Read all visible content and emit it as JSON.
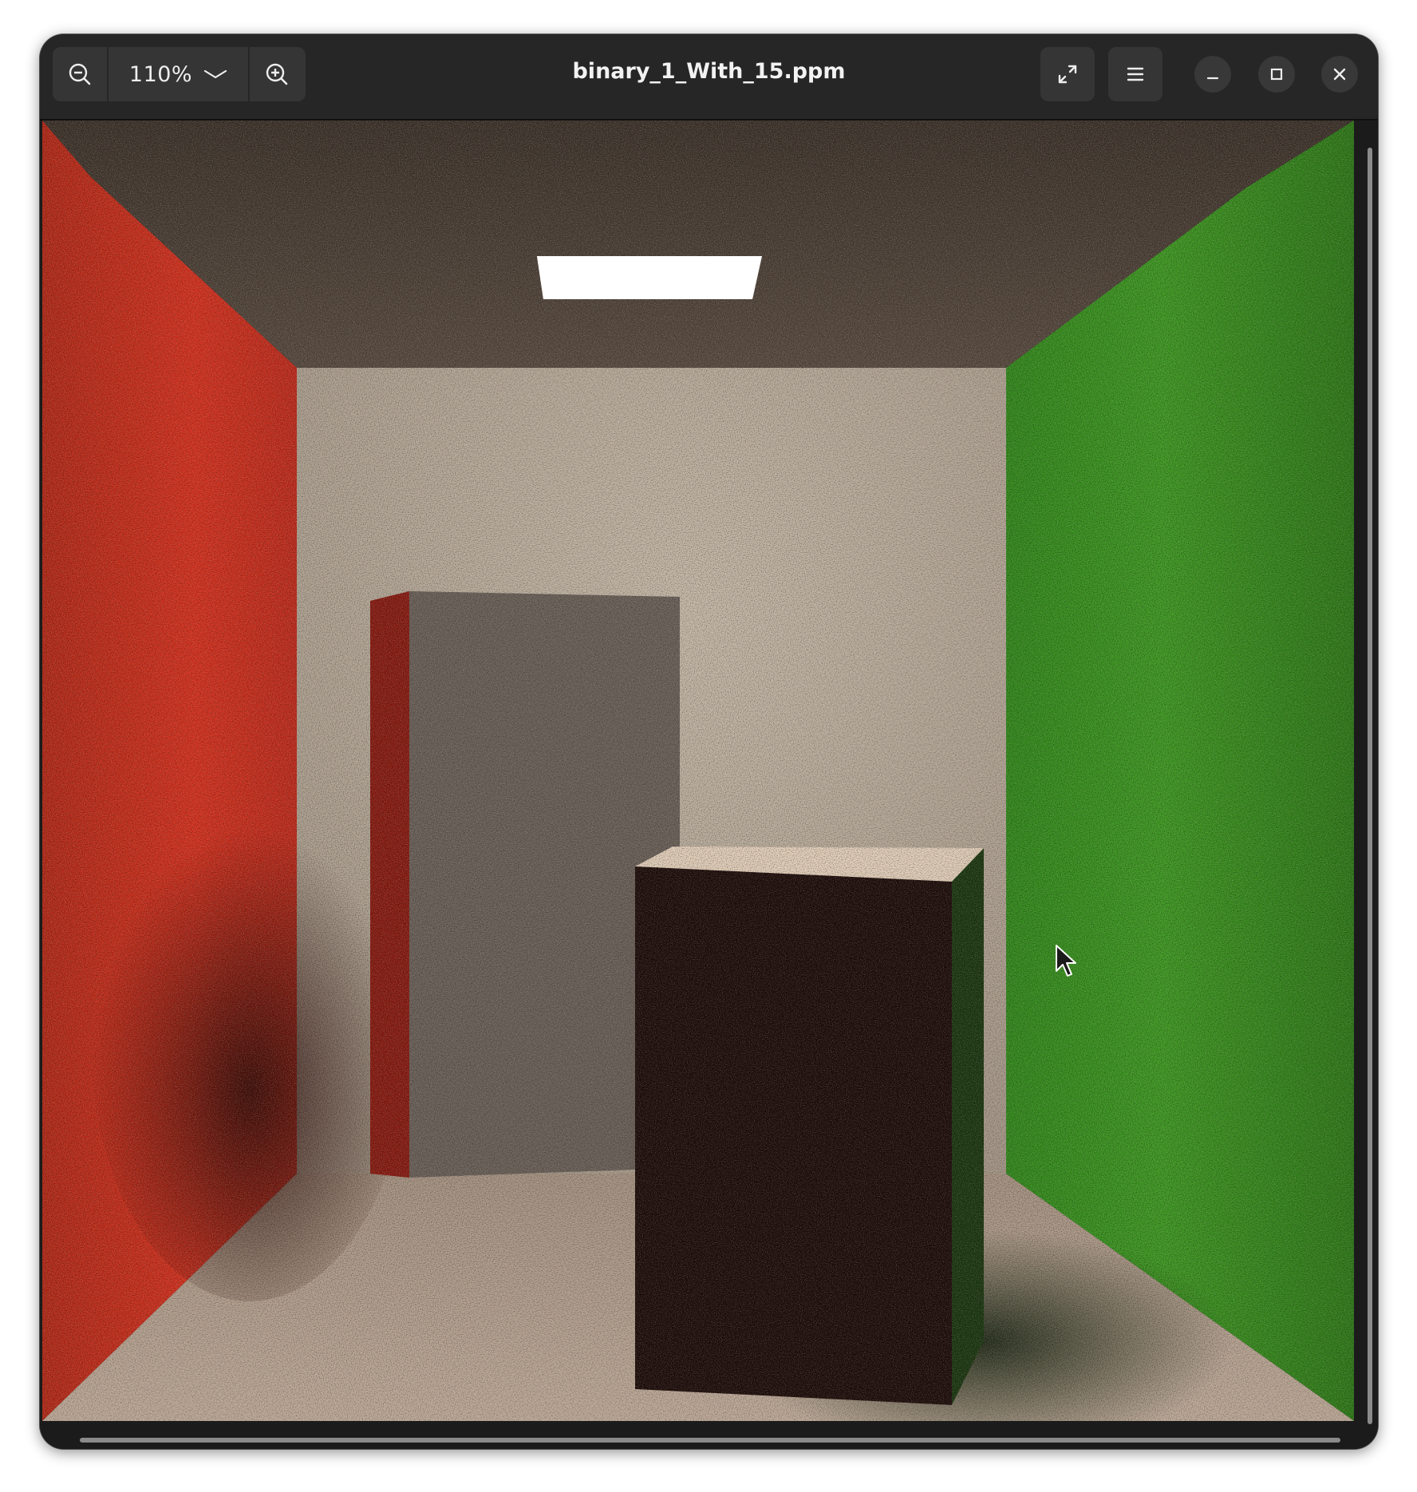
{
  "window": {
    "title": "binary_1_With_15.ppm"
  },
  "toolbar": {
    "zoom_out_icon": "zoom-out-icon",
    "zoom_level": "110%",
    "zoom_dropdown_icon": "chevron-down-icon",
    "zoom_in_icon": "zoom-in-icon",
    "fullscreen_icon": "fullscreen-icon",
    "menu_icon": "hamburger-menu-icon"
  },
  "window_controls": {
    "minimize_icon": "minimize-icon",
    "maximize_icon": "maximize-icon",
    "close_icon": "close-icon"
  },
  "image": {
    "description_icon": "cornell-box-render",
    "colors": {
      "left_wall": "#d8321f",
      "right_wall": "#3f9a22",
      "back_wall": "#bfb2a2",
      "floor": "#b8a494",
      "ceiling": "#55483e",
      "light": "#ffffff"
    }
  }
}
